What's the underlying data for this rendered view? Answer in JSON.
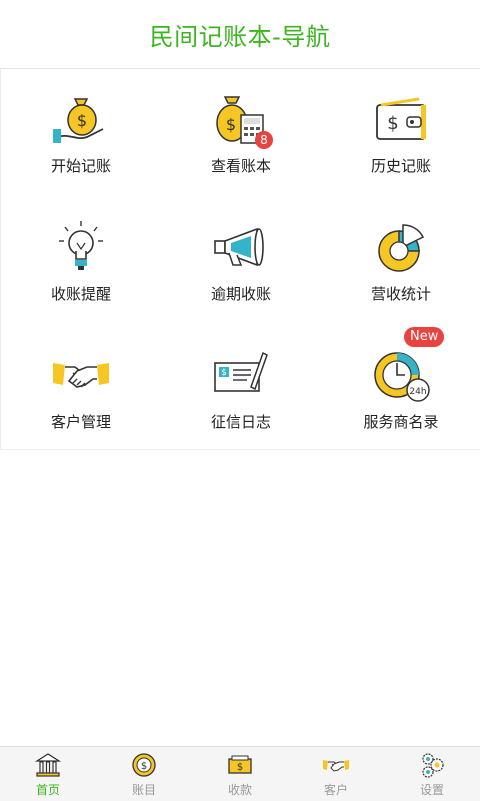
{
  "header": {
    "title": "民间记账本-导航"
  },
  "grid": {
    "items": [
      {
        "label": "开始记账",
        "icon": "money-bag-hand-icon"
      },
      {
        "label": "查看账本",
        "icon": "money-bag-calculator-icon"
      },
      {
        "label": "历史记账",
        "icon": "wallet-icon"
      },
      {
        "label": "收账提醒",
        "icon": "lightbulb-icon"
      },
      {
        "label": "逾期收账",
        "icon": "megaphone-icon",
        "badge": "8"
      },
      {
        "label": "营收统计",
        "icon": "pie-chart-icon"
      },
      {
        "label": "客户管理",
        "icon": "handshake-icon"
      },
      {
        "label": "征信日志",
        "icon": "check-pen-icon"
      },
      {
        "label": "服务商名录",
        "icon": "clock-24h-icon",
        "badge": "New"
      }
    ]
  },
  "tabbar": {
    "items": [
      {
        "label": "首页",
        "icon": "bank-icon",
        "active": true
      },
      {
        "label": "账目",
        "icon": "coin-icon",
        "active": false
      },
      {
        "label": "收款",
        "icon": "cash-icon",
        "active": false
      },
      {
        "label": "客户",
        "icon": "handshake-icon",
        "active": false
      },
      {
        "label": "设置",
        "icon": "gears-icon",
        "active": false
      }
    ]
  },
  "colors": {
    "accent": "#3cb521",
    "badge": "#e84340",
    "icon_yellow": "#f6c624",
    "icon_blue": "#35b3c8"
  }
}
